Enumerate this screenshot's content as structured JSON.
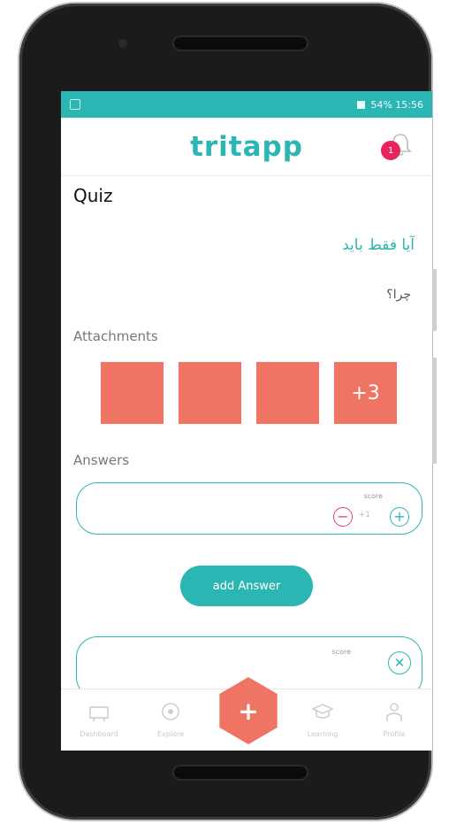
{
  "status": {
    "text": "54%  15:56"
  },
  "header": {
    "brand_part1": "trit",
    "brand_part2": "app",
    "notifications": "1"
  },
  "page": {
    "title": "Quiz",
    "question": "آیا فقط باید",
    "why": "چرا؟",
    "attachments_label": "Attachments",
    "attachments_more": "+3",
    "answers_label": "Answers"
  },
  "answer": {
    "score_label": "score",
    "score_value": "+1"
  },
  "add_answer_label": "add Answer",
  "answer2": {
    "score_label": "score"
  },
  "nav": {
    "items": [
      {
        "label": "Dashboard"
      },
      {
        "label": "Explore"
      },
      {
        "label": "Learning"
      },
      {
        "label": "Profile"
      }
    ]
  },
  "colors": {
    "primary": "#2bb5b3",
    "accent": "#f07463",
    "badge": "#e8245c"
  }
}
